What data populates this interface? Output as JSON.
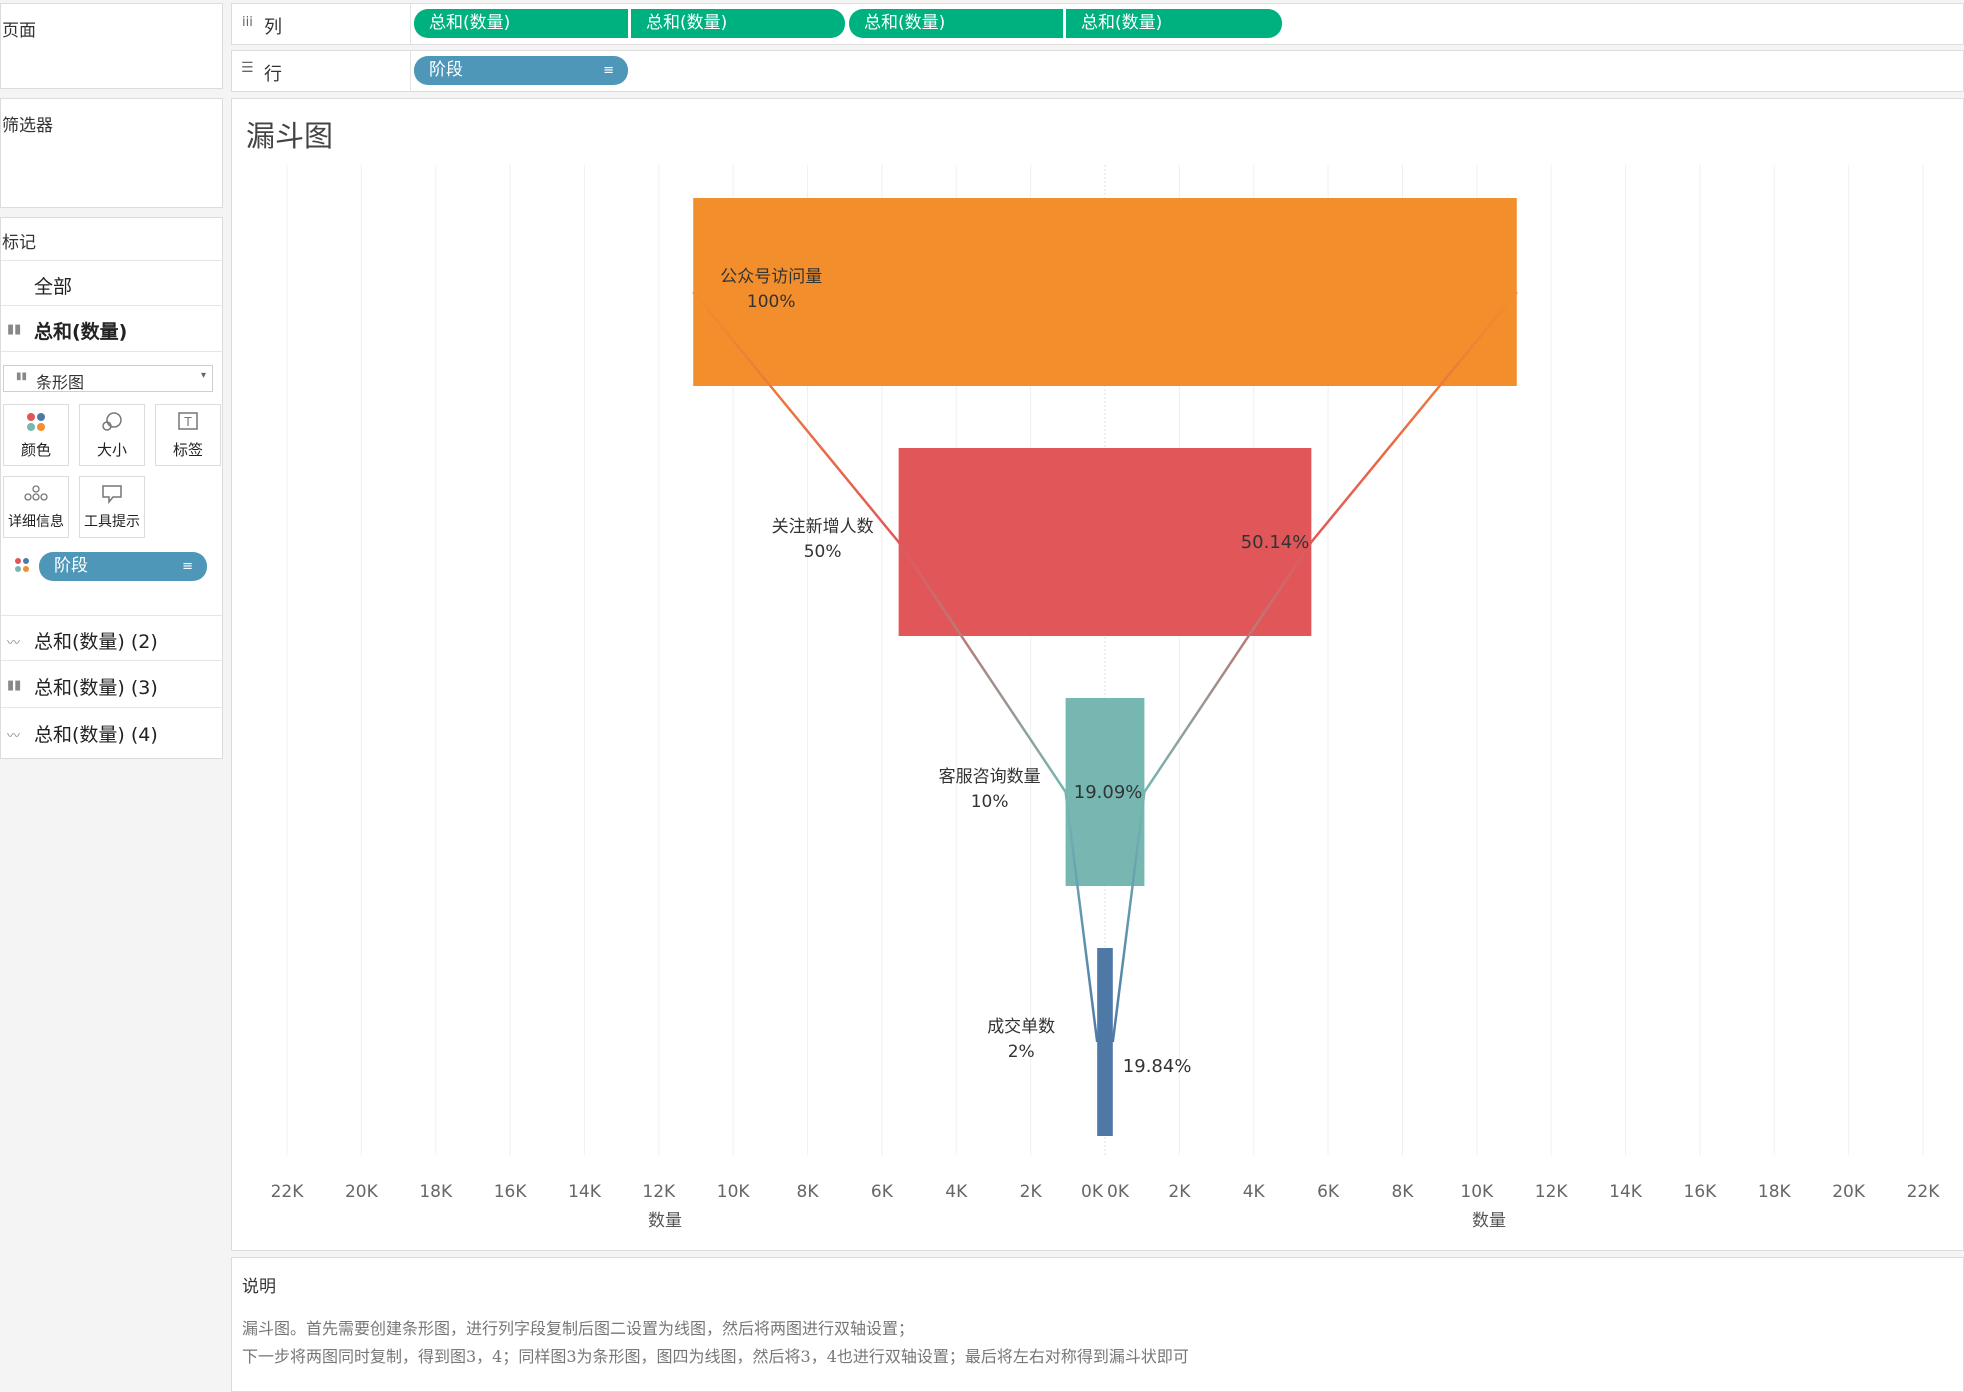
{
  "left_pane": {
    "pages_label": "页面",
    "filters_label": "筛选器",
    "marks_label": "标记",
    "all_label": "全部",
    "measure_label": "总和(数量)",
    "mark_type": "条形图",
    "buttons": {
      "color": "颜色",
      "size": "大小",
      "label": "标签",
      "detail": "详细信息",
      "tooltip": "工具提示"
    },
    "color_pill": "阶段",
    "layers": [
      "总和(数量) (2)",
      "总和(数量) (3)",
      "总和(数量) (4)"
    ]
  },
  "shelves": {
    "columns_label": "列",
    "columns_pills": [
      "总和(数量)",
      "总和(数量)",
      "总和(数量)",
      "总和(数量)"
    ],
    "rows_label": "行",
    "rows_pill": "阶段"
  },
  "sheet_title": "漏斗图",
  "colors": {
    "pill_green": "#00b180",
    "pill_blue": "#4f97b8",
    "stage_colors": [
      "#f28e2b",
      "#e15759",
      "#76b7b2",
      "#4e79a7"
    ]
  },
  "chart_data": {
    "type": "bar",
    "categories": [
      "公众号访问量",
      "关注新增人数",
      "客服咨询数量",
      "成交单数"
    ],
    "values": [
      22150,
      11100,
      2120,
      420
    ],
    "stage_share_labels": [
      "100%",
      "50%",
      "10%",
      "2%"
    ],
    "conversion_labels": [
      "",
      "50.14%",
      "19.09%",
      "19.84%"
    ],
    "xlabel_left": "数量",
    "xlabel_right": "数量",
    "xlim": [
      -22000,
      22000
    ],
    "left_ticks": [
      "22K",
      "20K",
      "18K",
      "16K",
      "14K",
      "12K",
      "10K",
      "8K",
      "6K",
      "4K",
      "2K",
      "0K"
    ],
    "right_ticks": [
      "0K",
      "2K",
      "4K",
      "6K",
      "8K",
      "10K",
      "12K",
      "14K",
      "16K",
      "18K",
      "20K",
      "22K"
    ],
    "grid": true
  },
  "description": {
    "title": "说明",
    "line1": "漏斗图。首先需要创建条形图，进行列字段复制后图二设置为线图，然后将两图进行双轴设置；",
    "line2": "下一步将两图同时复制，得到图3，4；同样图3为条形图，图四为线图，然后将3，4也进行双轴设置；最后将左右对称得到漏斗状即可"
  }
}
